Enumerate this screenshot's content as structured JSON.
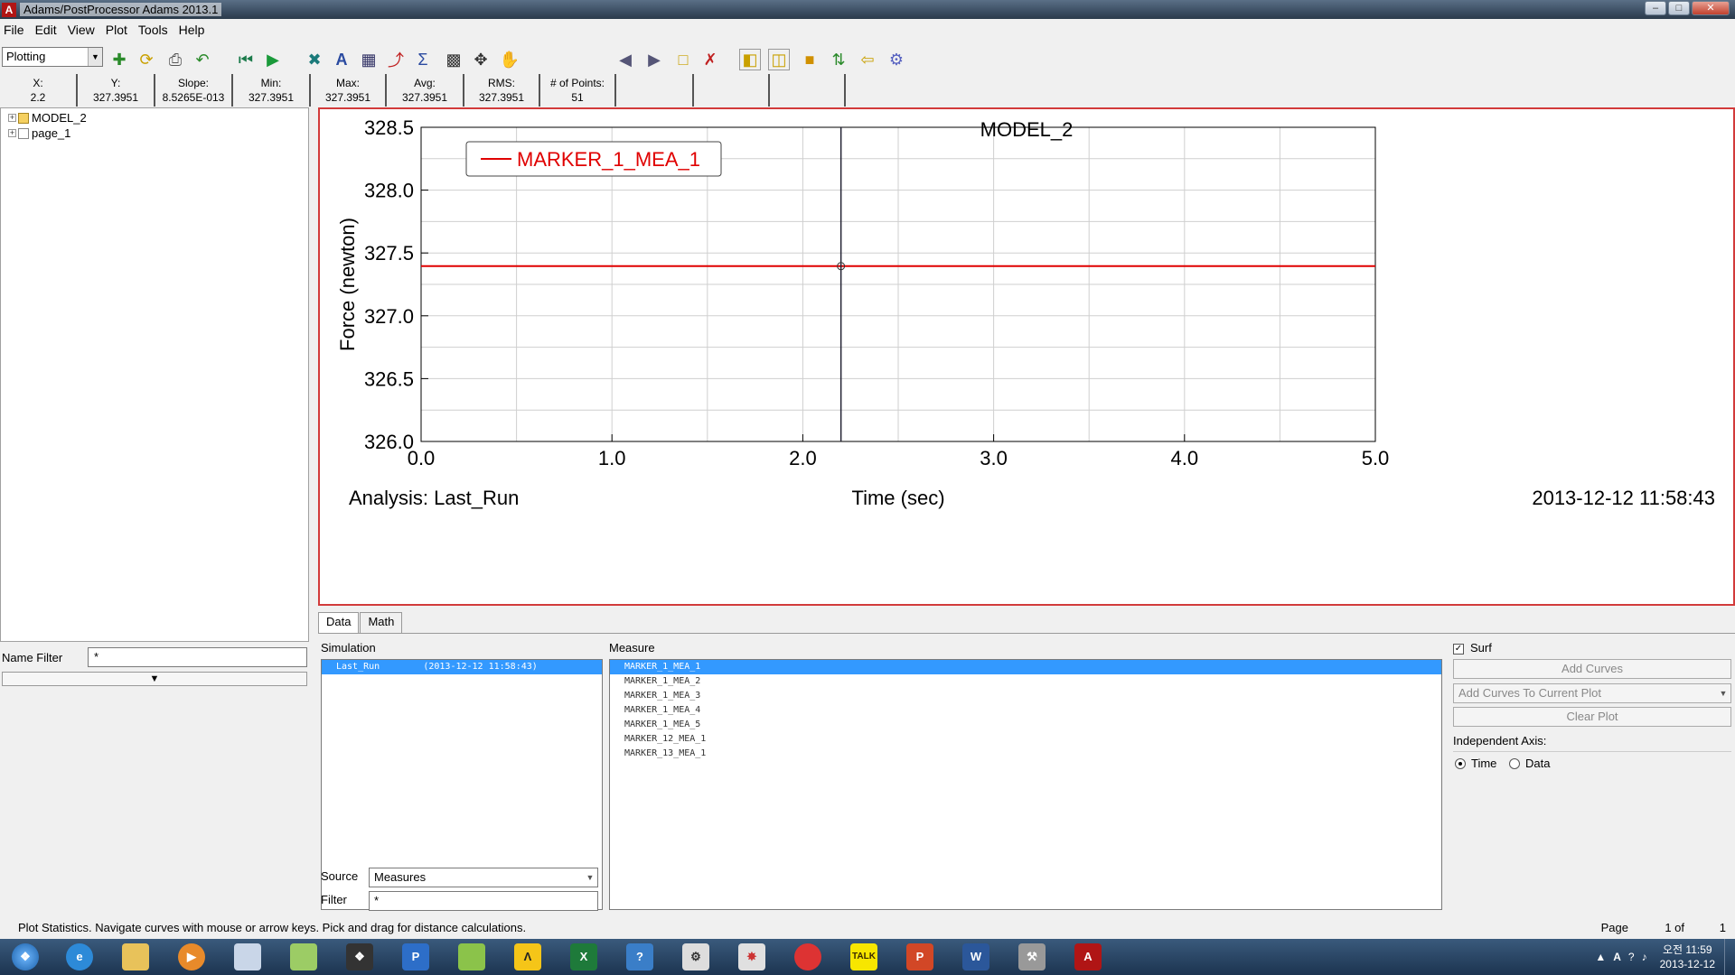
{
  "window": {
    "title": "Adams/PostProcessor Adams 2013.1",
    "app_icon": "A",
    "controls": [
      "minimize",
      "maximize",
      "close"
    ]
  },
  "menu": [
    "File",
    "Edit",
    "View",
    "Plot",
    "Tools",
    "Help"
  ],
  "toolbar": {
    "mode": "Plotting",
    "icons": [
      "new-page-icon",
      "refresh-icon",
      "print-icon",
      "undo-icon",
      "rewind-icon",
      "play-icon",
      "curve-edit-icon",
      "text-icon",
      "table-icon",
      "statistics-curve-icon",
      "sigma-icon",
      "zoom-box-icon",
      "fit-icon",
      "pan-hand-icon",
      "prev-page-icon",
      "next-page-icon",
      "page-layout-icon",
      "delete-page-icon",
      "layout-1-icon",
      "layout-2-icon",
      "layout-3-icon",
      "swap-icon",
      "import-icon",
      "settings-icon"
    ]
  },
  "stats": [
    {
      "label": "X:",
      "value": "2.2"
    },
    {
      "label": "Y:",
      "value": "327.3951"
    },
    {
      "label": "Slope:",
      "value": "8.5265E-013"
    },
    {
      "label": "Min:",
      "value": "327.3951"
    },
    {
      "label": "Max:",
      "value": "327.3951"
    },
    {
      "label": "Avg:",
      "value": "327.3951"
    },
    {
      "label": "RMS:",
      "value": "327.3951"
    },
    {
      "label": "# of Points:",
      "value": "51"
    },
    {
      "label": "",
      "value": ""
    },
    {
      "label": "",
      "value": ""
    },
    {
      "label": "",
      "value": ""
    }
  ],
  "tree": [
    {
      "label": "MODEL_2",
      "type": "model"
    },
    {
      "label": "page_1",
      "type": "page"
    }
  ],
  "name_filter": {
    "label": "Name Filter",
    "value": "*"
  },
  "plot": {
    "analysis_label": "Analysis:  Last_Run",
    "timestamp": "2013-12-12 11:58:43"
  },
  "chart_data": {
    "type": "line",
    "title": "MODEL_2",
    "xlabel": "Time (sec)",
    "ylabel": "Force (newton)",
    "xlim": [
      0.0,
      5.0
    ],
    "ylim": [
      326.0,
      328.5
    ],
    "xticks": [
      "0.0",
      "1.0",
      "2.0",
      "3.0",
      "4.0",
      "5.0"
    ],
    "yticks": [
      "326.0",
      "326.5",
      "327.0",
      "327.5",
      "328.0",
      "328.5"
    ],
    "grid": true,
    "legend_position": "top-left",
    "cursor_x": 2.2,
    "series": [
      {
        "name": "MARKER_1_MEA_1",
        "color": "#e00000",
        "x": [
          0.0,
          5.0
        ],
        "y": [
          327.3951,
          327.3951
        ]
      }
    ]
  },
  "tabs": [
    {
      "label": "Data",
      "active": true
    },
    {
      "label": "Math",
      "active": false
    }
  ],
  "data_panel": {
    "simulation_label": "Simulation",
    "simulations": [
      {
        "name": "Last_Run",
        "date": "(2013-12-12 11:58:43)",
        "selected": true
      }
    ],
    "measure_label": "Measure",
    "measures": [
      {
        "name": "MARKER_1_MEA_1",
        "selected": true
      },
      {
        "name": "MARKER_1_MEA_2",
        "selected": false
      },
      {
        "name": "MARKER_1_MEA_3",
        "selected": false
      },
      {
        "name": "MARKER_1_MEA_4",
        "selected": false
      },
      {
        "name": "MARKER_1_MEA_5",
        "selected": false
      },
      {
        "name": "MARKER_12_MEA_1",
        "selected": false
      },
      {
        "name": "MARKER_13_MEA_1",
        "selected": false
      }
    ],
    "source_label": "Source",
    "source_value": "Measures",
    "filter_label": "Filter",
    "filter_value": "*",
    "surf_label": "Surf",
    "surf_checked": true,
    "add_curves": "Add Curves",
    "add_mode": "Add Curves To Current Plot",
    "clear_plot": "Clear Plot",
    "independent_axis_label": "Independent Axis:",
    "axis_options": [
      "Time",
      "Data"
    ],
    "axis_selected": "Time"
  },
  "statusbar": {
    "message": "Plot Statistics.  Navigate curves with mouse or arrow keys.  Pick and drag for distance calculations.",
    "page_label": "Page",
    "page_current": "1 of",
    "page_total": "1"
  },
  "taskbar": {
    "apps": [
      "start-orb",
      "internet-explorer",
      "file-explorer",
      "media-player",
      "app-window",
      "notepad",
      "3d-app",
      "P",
      "hwp",
      "norton",
      "excel",
      "calc",
      "gear-app",
      "paint",
      "chrome",
      "TALK",
      "powerpoint",
      "word",
      "tools",
      "adams"
    ],
    "clock_time": "오전 11:59",
    "clock_date": "2013-12-12",
    "tray_ime": "A"
  }
}
